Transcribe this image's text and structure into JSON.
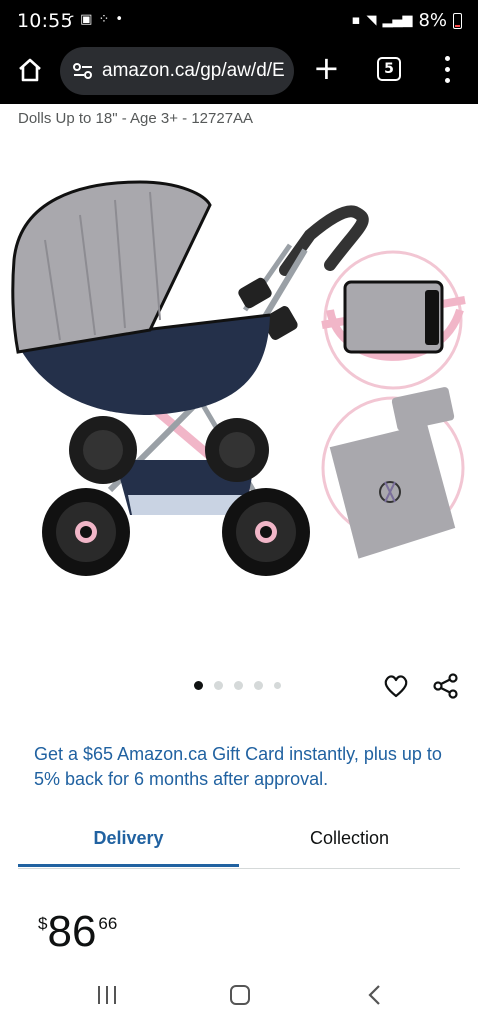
{
  "status_bar": {
    "time": "10:55",
    "left_icons": [
      "photos-icon",
      "calendar-icon",
      "grid-dots-icon",
      "dot-icon"
    ],
    "battery_percent": "8%",
    "right_icons": [
      "lock-icon",
      "wifi-icon",
      "signal-icon",
      "battery-icon"
    ]
  },
  "browser": {
    "url": "amazon.ca/gp/aw/d/E",
    "tab_count": "5",
    "new_tab_label": "+"
  },
  "product": {
    "title_fragment": "Dolls Up to 18\" - Age 3+ - 12727AA",
    "image_alt": "doll pram product photo",
    "carousel": {
      "total": 5,
      "active_index": 0
    }
  },
  "promo": {
    "text": "Get a $65 Amazon.ca Gift Card instantly, plus up to 5% back for 6 months after approval."
  },
  "tabs": [
    {
      "label": "Delivery",
      "selected": true
    },
    {
      "label": "Collection",
      "selected": false
    }
  ],
  "price": {
    "symbol": "$",
    "whole": "86",
    "fraction": "66"
  },
  "colors": {
    "link_blue": "#2162a1",
    "status_bar_bg": "#000000",
    "url_pill_bg": "#2b2d31",
    "pram_grey": "#a9a8ad",
    "pram_navy": "#24304a",
    "pram_pink": "#f1b6c8"
  }
}
